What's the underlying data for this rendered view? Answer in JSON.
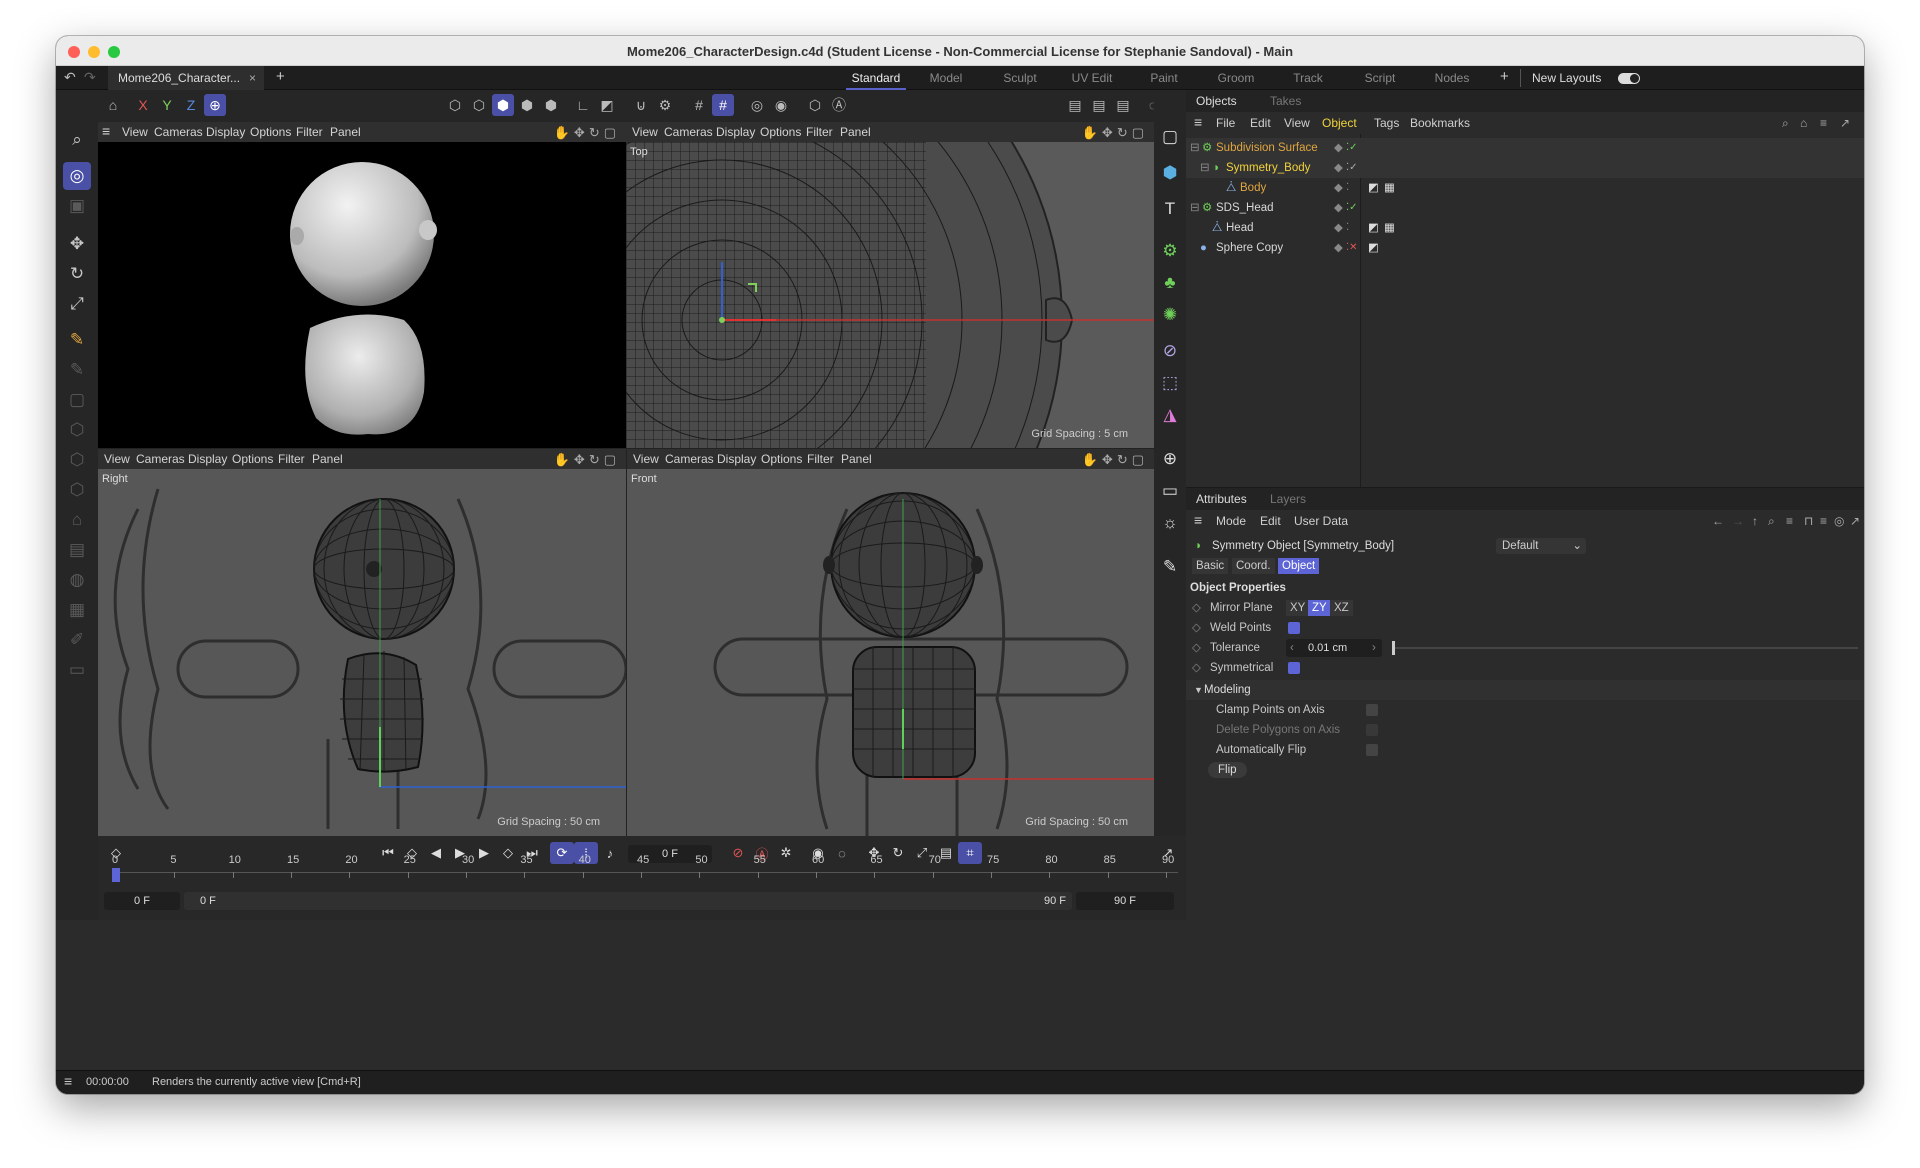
{
  "window": {
    "title": "Mome206_CharacterDesign.c4d (Student License - Non-Commercial License for Stephanie Sandoval) - Main"
  },
  "tabbar": {
    "doc_tab": "Mome206_Character...",
    "doc_close": "×",
    "add": "+",
    "layouts": [
      "Standard",
      "Model",
      "Sculpt",
      "UV Edit",
      "Paint",
      "Groom",
      "Track",
      "Script",
      "Nodes"
    ],
    "active_layout": "Standard",
    "new_layouts": "New Layouts"
  },
  "toolbar": {
    "axis_x": "X",
    "axis_y": "Y",
    "axis_z": "Z"
  },
  "viewports": {
    "menu": [
      "View",
      "Cameras",
      "Display",
      "Options",
      "Filter",
      "Panel"
    ],
    "perspective": {
      "label": ""
    },
    "top": {
      "label": "Top",
      "grid": "Grid Spacing : 5 cm"
    },
    "right": {
      "label": "Right",
      "grid": "Grid Spacing : 50 cm"
    },
    "front": {
      "label": "Front",
      "grid": "Grid Spacing : 50 cm"
    }
  },
  "objects_panel": {
    "tabs": [
      "Objects",
      "Takes"
    ],
    "menu": [
      "File",
      "Edit",
      "View",
      "Object",
      "Tags",
      "Bookmarks"
    ],
    "active_menu": "Object",
    "rows": [
      {
        "name": "Subdivision Surface",
        "color": "#e0a640"
      },
      {
        "name": "Symmetry_Body",
        "color": "#f2d33c"
      },
      {
        "name": "Body",
        "color": "#e0a640"
      },
      {
        "name": "SDS_Head",
        "color": "#d8d8d8"
      },
      {
        "name": "Head",
        "color": "#d8d8d8"
      },
      {
        "name": "Sphere Copy",
        "color": "#d8d8d8"
      }
    ]
  },
  "attributes_panel": {
    "tabs": [
      "Attributes",
      "Layers"
    ],
    "menu": [
      "Mode",
      "Edit",
      "User Data"
    ],
    "object_title": "Symmetry Object [Symmetry_Body]",
    "preset": "Default",
    "subtabs": [
      "Basic",
      "Coord.",
      "Object"
    ],
    "active_subtab": "Object",
    "section": "Object Properties",
    "mirror_plane_label": "Mirror Plane",
    "mirror_plane_options": [
      "XY",
      "ZY",
      "XZ"
    ],
    "mirror_plane_selected": "ZY",
    "weld_points_label": "Weld Points",
    "weld_points": true,
    "tolerance_label": "Tolerance",
    "tolerance_value": "0.01 cm",
    "symmetrical_label": "Symmetrical",
    "symmetrical": true,
    "modeling_label": "Modeling",
    "clamp_label": "Clamp Points on Axis",
    "delete_label": "Delete Polygons on Axis",
    "autoflip_label": "Automatically Flip",
    "flip_button": "Flip"
  },
  "timeline": {
    "current_frame": "0 F",
    "ticks": [
      "0",
      "5",
      "10",
      "15",
      "20",
      "25",
      "30",
      "35",
      "40",
      "45",
      "50",
      "55",
      "60",
      "65",
      "70",
      "75",
      "80",
      "85",
      "90"
    ],
    "range_start": "0 F",
    "range_start2": "0 F",
    "range_end": "90 F",
    "range_end2": "90 F"
  },
  "statusbar": {
    "time": "00:00:00",
    "message": "Renders the currently active view [Cmd+R]"
  }
}
